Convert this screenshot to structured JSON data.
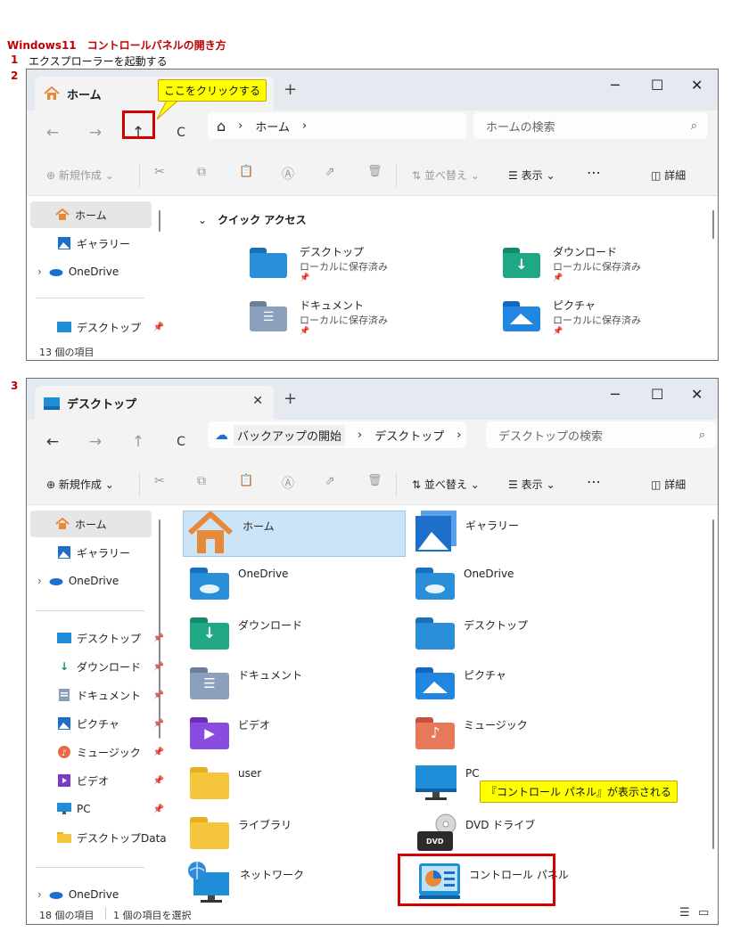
{
  "doc": {
    "title": "Windows11　コントロールパネルの開き方",
    "step1_num": "1",
    "step1_text": "エクスプローラーを起動する",
    "step2_num": "2",
    "step3_num": "3"
  },
  "window1": {
    "tab_title": "ホーム",
    "tab_add": "+",
    "minimize": "─",
    "maximize": "☐",
    "close": "✕",
    "nav": {
      "back": "←",
      "forward": "→",
      "up": "↑",
      "refresh": "C"
    },
    "address": {
      "home_glyph": "⌂",
      "sep": "›",
      "location": "ホーム",
      "sep2": "›"
    },
    "search_placeholder": "ホームの検索",
    "search_glyph": "⌕",
    "cmd": {
      "new": "新規作成",
      "new_glyph": "⊕",
      "chev": "⌄",
      "cut": "✂",
      "copy": "⧉",
      "paste": "📋",
      "rename": "Ⓐ",
      "share": "⇗",
      "delete": "🗑",
      "sort": "並べ替え",
      "sort_glyph": "⇅",
      "view": "表示",
      "view_glyph": "☰",
      "more": "⋯",
      "details": "詳細",
      "details_glyph": "◫"
    },
    "sidebar": [
      {
        "label": "ホーム"
      },
      {
        "label": "ギャラリー"
      },
      {
        "label": "OneDrive"
      },
      {
        "label": "デスクトップ"
      }
    ],
    "expand_glyph": "›",
    "pin_glyph": "📌",
    "quick_access": {
      "toggle": "⌄",
      "header": "クイック アクセス",
      "items": [
        {
          "name": "デスクトップ",
          "sub": "ローカルに保存済み"
        },
        {
          "name": "ダウンロード",
          "sub": "ローカルに保存済み"
        },
        {
          "name": "ドキュメント",
          "sub": "ローカルに保存済み"
        },
        {
          "name": "ピクチャ",
          "sub": "ローカルに保存済み"
        }
      ]
    },
    "status": "13 個の項目",
    "callout": "ここをクリックする"
  },
  "window2": {
    "tab_title": "デスクトップ",
    "tab_close": "✕",
    "tab_add": "+",
    "minimize": "─",
    "maximize": "☐",
    "close": "✕",
    "nav": {
      "back": "←",
      "forward": "→",
      "up": "↑",
      "refresh": "C"
    },
    "address": {
      "backup_glyph": "☁",
      "backup": "バックアップの開始",
      "sep": "›",
      "location": "デスクトップ",
      "sep2": "›"
    },
    "search_placeholder": "デスクトップの検索",
    "search_glyph": "⌕",
    "cmd": {
      "new": "新規作成",
      "new_glyph": "⊕",
      "chev": "⌄",
      "cut": "✂",
      "copy": "⧉",
      "paste": "📋",
      "rename": "Ⓐ",
      "share": "⇗",
      "delete": "🗑",
      "sort": "並べ替え",
      "sort_glyph": "⇅",
      "view": "表示",
      "view_glyph": "☰",
      "more": "⋯",
      "details": "詳細",
      "details_glyph": "◫"
    },
    "sidebar": [
      {
        "label": "ホーム"
      },
      {
        "label": "ギャラリー"
      },
      {
        "label": "OneDrive"
      },
      {
        "label": "デスクトップ"
      },
      {
        "label": "ダウンロード"
      },
      {
        "label": "ドキュメント"
      },
      {
        "label": "ピクチャ"
      },
      {
        "label": "ミュージック"
      },
      {
        "label": "ビデオ"
      },
      {
        "label": "PC"
      },
      {
        "label": "デスクトップData"
      },
      {
        "label": "OneDrive"
      }
    ],
    "expand_glyph": "›",
    "pin_glyph": "📌",
    "items": [
      {
        "name": "ホーム"
      },
      {
        "name": "ギャラリー"
      },
      {
        "name": "OneDrive"
      },
      {
        "name": "OneDrive"
      },
      {
        "name": "ダウンロード"
      },
      {
        "name": "デスクトップ"
      },
      {
        "name": "ドキュメント"
      },
      {
        "name": "ピクチャ"
      },
      {
        "name": "ビデオ"
      },
      {
        "name": "ミュージック"
      },
      {
        "name": "user"
      },
      {
        "name": "PC"
      },
      {
        "name": "ライブラリ"
      },
      {
        "name": "DVD ドライブ"
      },
      {
        "name": "ネットワーク"
      },
      {
        "name": "コントロール パネル"
      }
    ],
    "dvd_label": "DVD",
    "status_count": "18 個の項目",
    "status_selected": "1 個の項目を選択",
    "view_list_glyph": "☰",
    "view_tile_glyph": "▭",
    "callout": "『コントロール パネル』が表示される"
  },
  "colors": {
    "accent_red": "#c00000",
    "callout_yellow": "#ffff00",
    "highlight_box": "#d40000",
    "selection": "#cce4f7"
  }
}
